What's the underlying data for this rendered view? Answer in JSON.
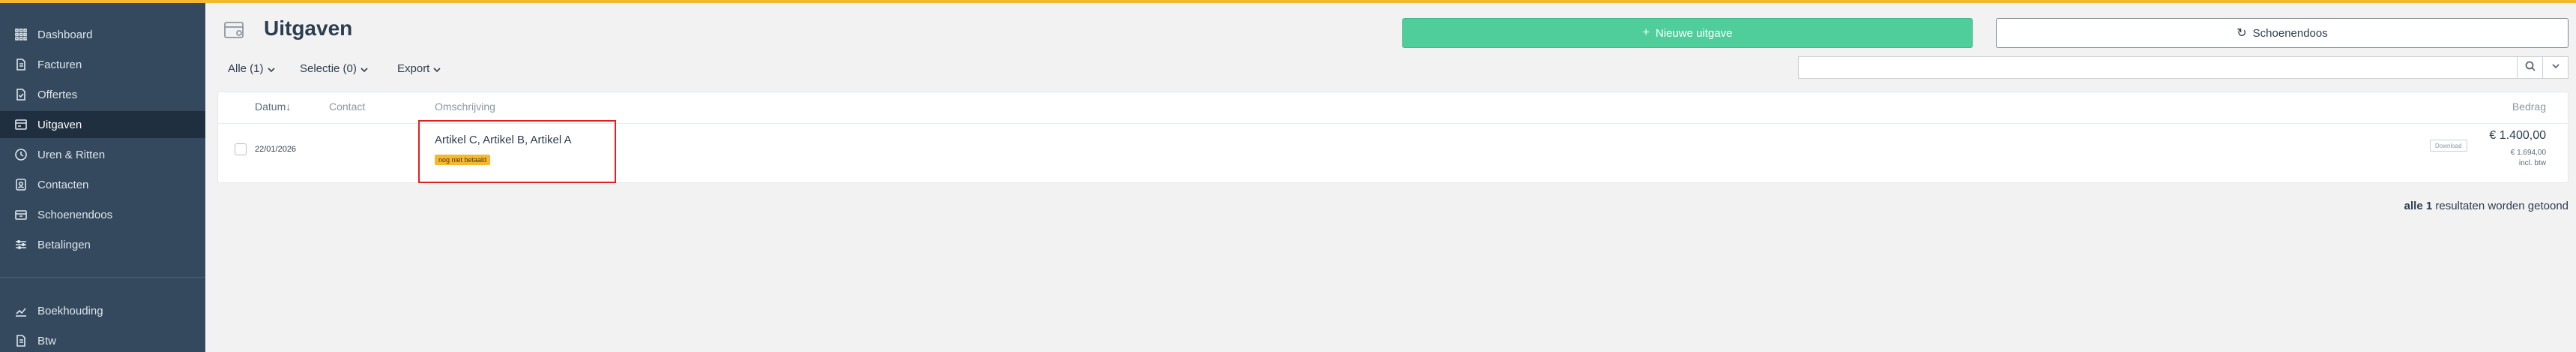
{
  "sidebar": {
    "items": [
      {
        "label": "Dashboard",
        "icon": "grid-icon",
        "active": false
      },
      {
        "label": "Facturen",
        "icon": "document-icon",
        "active": false
      },
      {
        "label": "Offertes",
        "icon": "document-check-icon",
        "active": false
      },
      {
        "label": "Uitgaven",
        "icon": "receipt-icon",
        "active": true
      },
      {
        "label": "Uren & Ritten",
        "icon": "clock-icon",
        "active": false
      },
      {
        "label": "Contacten",
        "icon": "contact-icon",
        "active": false
      },
      {
        "label": "Schoenendoos",
        "icon": "box-icon",
        "active": false
      },
      {
        "label": "Betalingen",
        "icon": "sliders-icon",
        "active": false
      }
    ],
    "bottom_items": [
      {
        "label": "Boekhouding",
        "icon": "chart-icon"
      },
      {
        "label": "Btw",
        "icon": "document-icon"
      }
    ]
  },
  "header": {
    "title": "Uitgaven",
    "new_button": "Nieuwe uitgave",
    "box_button": "Schoenendoos"
  },
  "filters": {
    "all": "Alle (1)",
    "selection": "Selectie (0)",
    "export": "Export"
  },
  "search": {
    "placeholder": "",
    "value": ""
  },
  "table": {
    "columns": {
      "date": "Datum↓",
      "contact": "Contact",
      "description": "Omschrijving",
      "amount": "Bedrag"
    },
    "rows": [
      {
        "date": "22/01/2026",
        "contact": "",
        "description": "Artikel C, Artikel B, Artikel A",
        "status": "nog niet betaald",
        "download": "Download",
        "amount": "€ 1.400,00",
        "amount_incl": "€ 1.694,00",
        "amount_note": "incl. btw"
      }
    ]
  },
  "footer": {
    "results_count": "alle 1",
    "results_text": " resultaten worden getoond"
  },
  "colors": {
    "accent_bar": "#f5b82e",
    "sidebar_bg": "#34495e",
    "primary_green": "#4fce9c",
    "highlight_red": "#e02020"
  }
}
